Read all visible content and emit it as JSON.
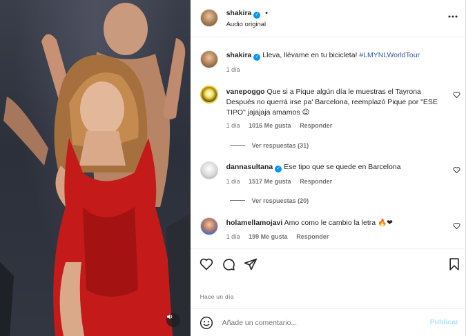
{
  "video": {
    "mute_icon": "speaker-icon"
  },
  "header": {
    "username": "shakira",
    "separator": "•",
    "subtitle": "Audio original",
    "more_icon": "more-options-icon"
  },
  "caption": {
    "username": "shakira",
    "text": "Lleva, llévame en tu bicicleta!",
    "hashtag": "#LMYNLWorldTour",
    "time": "1 día"
  },
  "comments": [
    {
      "username": "vanepoggo",
      "text": "Que si a Pique algún día le muestras el Tayrona Después no querrá irse pa' Barcelona, reemplazó Pique por \"ESE TIPO\" jajajaja amamos 😉",
      "time": "1 día",
      "likes": "1016 Me gusta",
      "reply": "Responder",
      "view_replies": "Ver respuestas (31)",
      "verified": false
    },
    {
      "username": "dannasultana",
      "text": "Ese tipo que se quede en Barcelona",
      "time": "1 día",
      "likes": "1517 Me gusta",
      "reply": "Responder",
      "view_replies": "Ver respuestas (20)",
      "verified": true
    },
    {
      "username": "holamellamojavi",
      "text": "Amo como le cambio la letra 🔥❤",
      "time": "1 día",
      "likes": "199 Me gusta",
      "reply": "Responder",
      "verified": false
    }
  ],
  "footer": {
    "timestamp": "Hace un día",
    "comment_placeholder": "Añade un comentario...",
    "publish_label": "Publicar"
  },
  "colors": {
    "verified_blue": "#0095f6",
    "hashtag": "#3b5998",
    "publish_disabled": "#b2dffc",
    "dress_red": "#c41a1a"
  }
}
